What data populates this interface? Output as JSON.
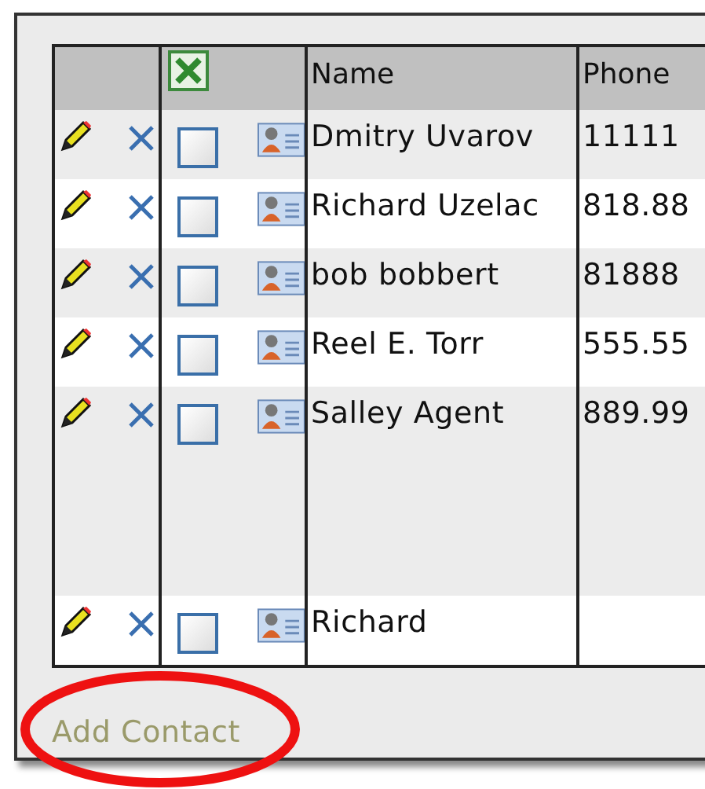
{
  "table": {
    "columns": [
      "Name",
      "Phone"
    ],
    "rows": [
      {
        "name": "Dmitry Uvarov",
        "phone": "11111",
        "checked": false
      },
      {
        "name": "Richard Uzelac",
        "phone": "818.88",
        "checked": false
      },
      {
        "name": "bob bobbert",
        "phone": "81888",
        "checked": false
      },
      {
        "name": "Reel E. Torr",
        "phone": "555.55",
        "checked": false
      },
      {
        "name": "Salley Agent",
        "phone": "889.99",
        "checked": false
      },
      {
        "name": "Richard",
        "checked": false
      }
    ]
  },
  "add_link": "Add Contact"
}
